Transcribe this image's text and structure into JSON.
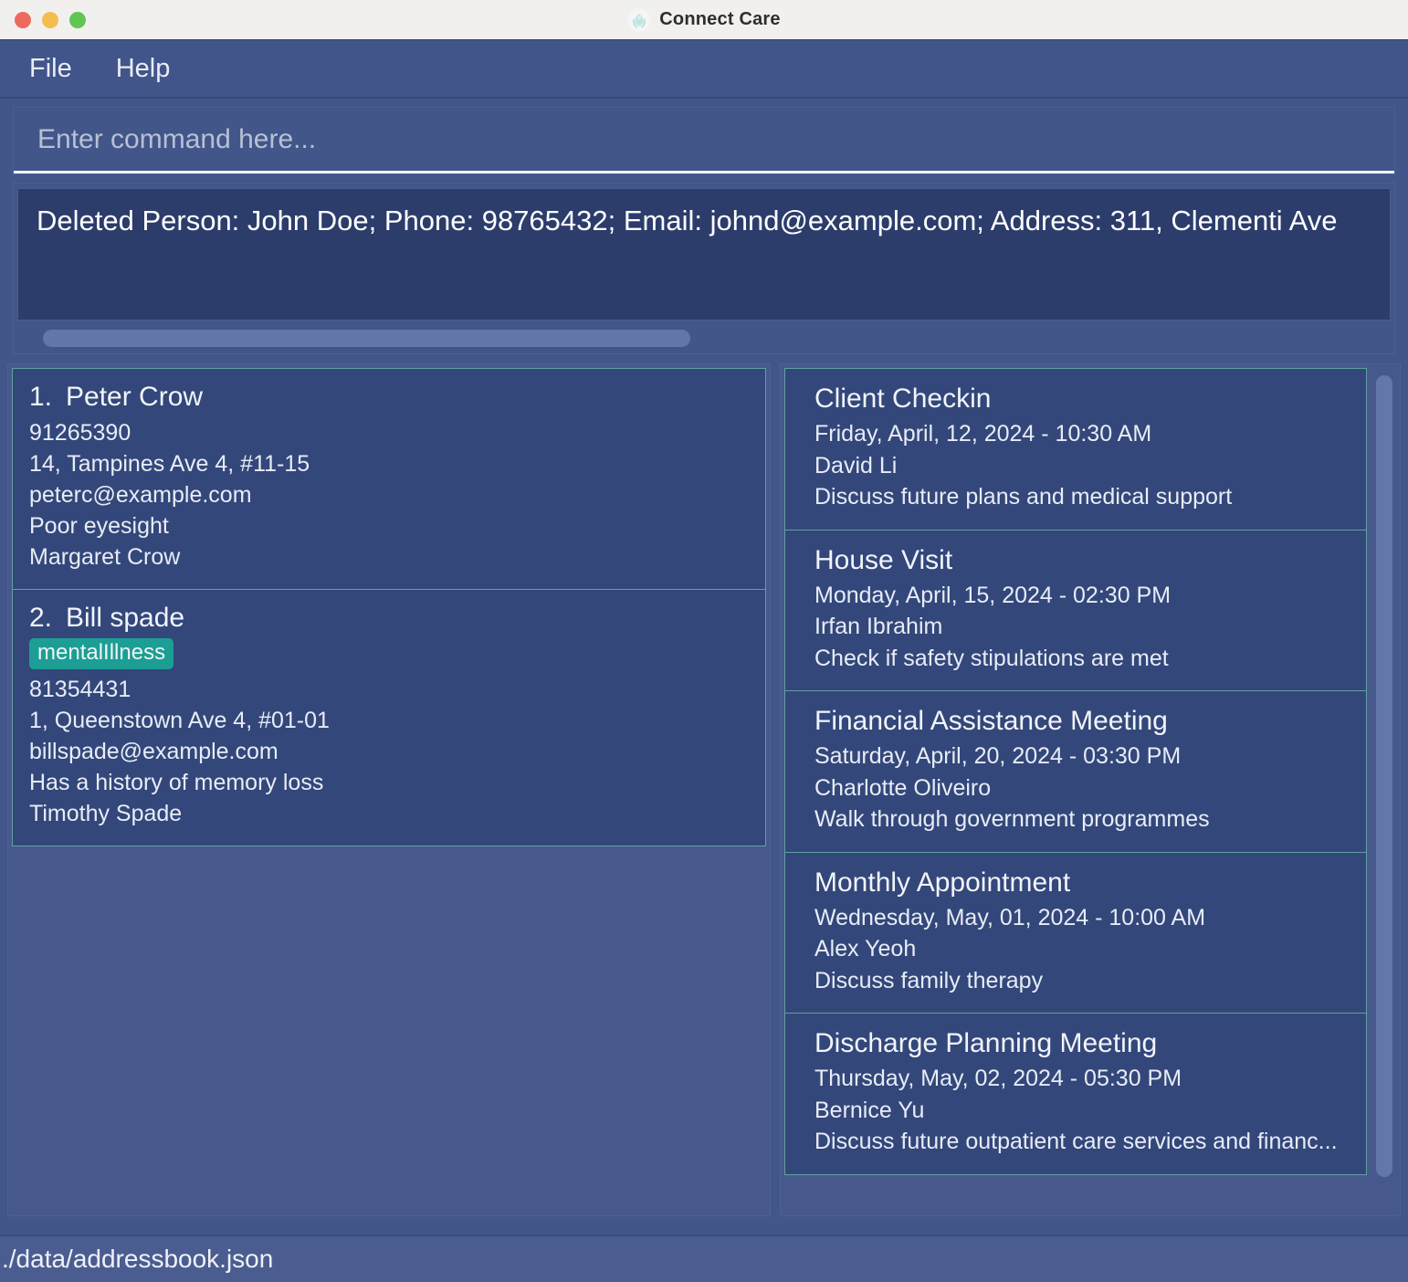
{
  "window": {
    "title": "Connect Care",
    "logo_icon": "connect-care-logo-icon",
    "traffic_lights": [
      "close-button",
      "minimize-button",
      "maximize-button"
    ]
  },
  "menubar": {
    "items": [
      {
        "label": "File"
      },
      {
        "label": "Help"
      }
    ]
  },
  "command": {
    "placeholder": "Enter command here...",
    "value": ""
  },
  "result": {
    "text": "Deleted Person: John Doe; Phone: 98765432; Email: johnd@example.com; Address: 311, Clementi Ave"
  },
  "persons": [
    {
      "index": "1.",
      "name": "Peter Crow",
      "tags": [],
      "phone": "91265390",
      "address": "14, Tampines Ave 4, #11-15",
      "email": "peterc@example.com",
      "note": "Poor eyesight",
      "nextofkin": "Margaret Crow"
    },
    {
      "index": "2.",
      "name": "Bill spade",
      "tags": [
        "mentalIllness"
      ],
      "phone": "81354431",
      "address": "1, Queenstown Ave 4, #01-01",
      "email": "billspade@example.com",
      "note": "Has a history of memory loss",
      "nextofkin": "Timothy Spade"
    }
  ],
  "appointments": [
    {
      "title": "Client Checkin",
      "datetime": "Friday, April, 12, 2024 - 10:30 AM",
      "person": "David Li",
      "description": "Discuss future plans and medical support"
    },
    {
      "title": "House Visit",
      "datetime": "Monday, April, 15, 2024 - 02:30 PM",
      "person": "Irfan Ibrahim",
      "description": "Check if safety stipulations are met"
    },
    {
      "title": "Financial Assistance Meeting",
      "datetime": "Saturday, April, 20, 2024 - 03:30 PM",
      "person": "Charlotte Oliveiro",
      "description": "Walk through government programmes"
    },
    {
      "title": "Monthly Appointment",
      "datetime": "Wednesday, May, 01, 2024 - 10:00 AM",
      "person": "Alex Yeoh",
      "description": "Discuss family therapy"
    },
    {
      "title": "Discharge Planning Meeting",
      "datetime": "Thursday, May, 02, 2024 - 05:30 PM",
      "person": "Bernice Yu",
      "description": "Discuss future outpatient care services and financ..."
    }
  ],
  "statusbar": {
    "save_location": "./data/addressbook.json"
  },
  "colors": {
    "window_background": "#42568a",
    "panel_background": "#47598c",
    "card_background": "#33477a",
    "card_border": "#60a1a0",
    "result_background": "#2c3c6b",
    "tag_background": "#1d9e95",
    "scrollbar_thumb": "#6377ab",
    "titlebar_background": "#f1f0ee",
    "statusbar_background": "#4b5d90"
  }
}
